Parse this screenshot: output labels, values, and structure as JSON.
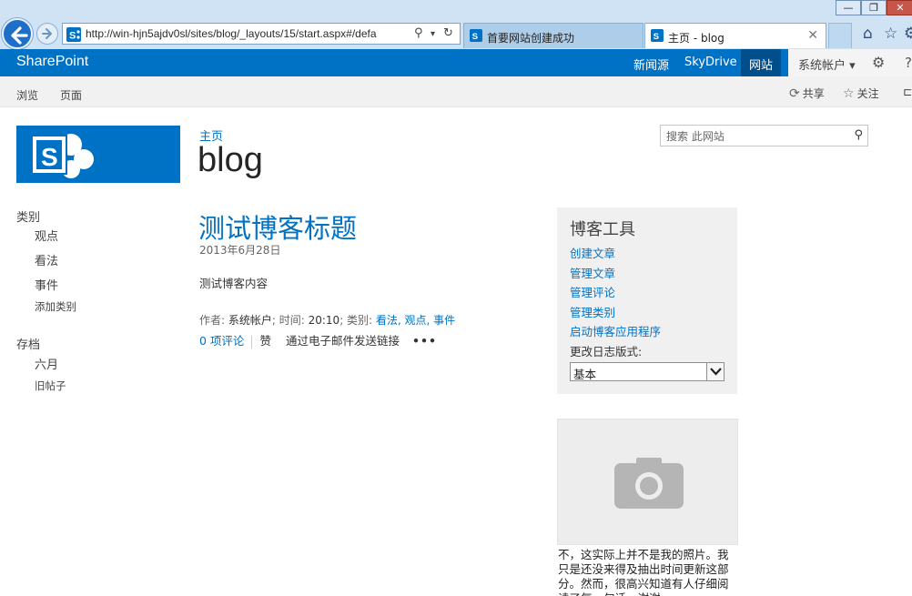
{
  "browser": {
    "address_url": "http://win-hjn5ajdv0sl/sites/blog/_layouts/15/start.aspx#/defa",
    "tabs": [
      {
        "label": "首要网站创建成功"
      },
      {
        "label": "主页 - blog"
      }
    ]
  },
  "suite_bar": {
    "brand": "SharePoint",
    "links": [
      "新闻源",
      "SkyDrive",
      "网站"
    ],
    "active_link": "网站",
    "user": "系统帐户 ▾",
    "accent_color": "#0072c6"
  },
  "ribbon": {
    "tabs": [
      "浏览",
      "页面"
    ],
    "share": "共享",
    "follow": "关注"
  },
  "header": {
    "breadcrumb": "主页",
    "site_title": "blog",
    "search_placeholder": "搜索 此网站"
  },
  "left_nav": {
    "categories_heading": "类别",
    "categories": [
      "观点",
      "看法",
      "事件",
      "添加类别"
    ],
    "archive_heading": "存档",
    "archive": [
      "六月",
      "旧帖子"
    ]
  },
  "post": {
    "title": "测试博客标题",
    "date": "2013年6月28日",
    "body": "测试博客内容",
    "meta_author_label": "作者: ",
    "meta_author": "系统帐户",
    "meta_time_label": "; 时间: ",
    "meta_time": "20:10",
    "meta_category_label": "; 类别: ",
    "meta_categories": "看法, 观点, 事件",
    "comments": "0 项评论",
    "like": "赞",
    "email_link": "通过电子邮件发送链接",
    "more": "•••"
  },
  "blog_tools": {
    "heading": "博客工具",
    "links": [
      "创建文章",
      "管理文章",
      "管理评论",
      "管理类别",
      "启动博客应用程序"
    ],
    "style_label": "更改日志版式:",
    "style_value": "基本"
  },
  "photo": {
    "icon": "camera-icon",
    "caption": "不，这实际上并不是我的照片。我只是还没来得及抽出时间更新这部分。然而，很高兴知道有人仔细阅读了每一句话。谢谢"
  }
}
